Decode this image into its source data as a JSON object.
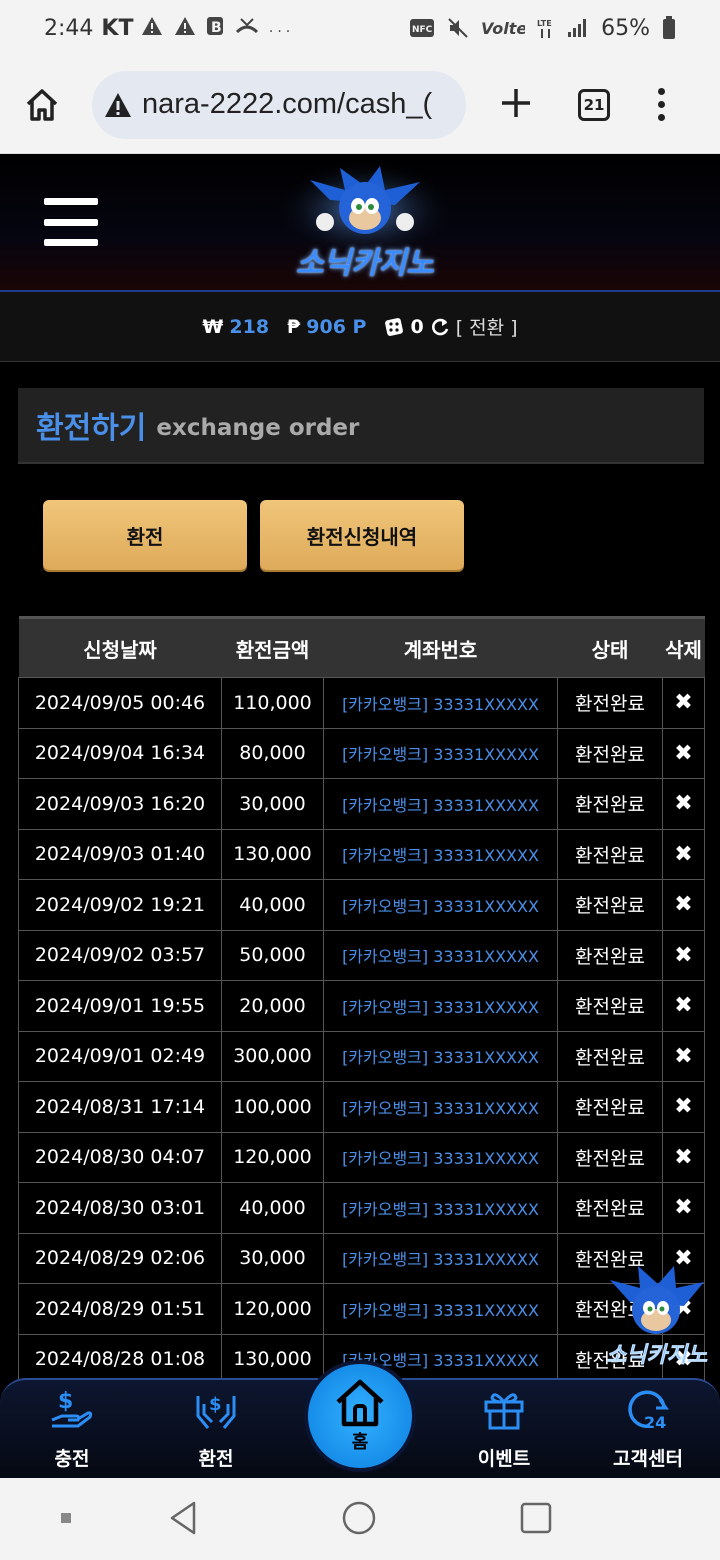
{
  "status": {
    "time": "2:44",
    "carrier": "KT",
    "battery": "65%",
    "icons": [
      "warning-icon",
      "warning-icon",
      "b-icon",
      "missed-call-icon",
      "more-icon",
      "nfc-icon",
      "mute-icon",
      "volte-icon",
      "lte-icon",
      "signal-icon",
      "battery-icon"
    ]
  },
  "browser": {
    "url": "nara-2222.com/cash_(",
    "tab_count": "21"
  },
  "site": {
    "logo_text": "소닉카지노"
  },
  "balance": {
    "won_symbol": "₩",
    "won_value": "218",
    "point_symbol": "₱",
    "point_value": "906 P",
    "chip_value": "0",
    "convert_label": "[ 전환 ]"
  },
  "page": {
    "title_ko": "환전하기",
    "title_en": "exchange order"
  },
  "buttons": {
    "exchange": "환전",
    "history": "환전신청내역"
  },
  "table": {
    "headers": [
      "신청날짜",
      "환전금액",
      "계좌번호",
      "상태",
      "삭제"
    ],
    "rows": [
      {
        "date": "2024/09/05 00:46",
        "amount": "110,000",
        "account": "[카카오뱅크] 33331XXXXX",
        "status": "환전완료",
        "del": "✖"
      },
      {
        "date": "2024/09/04 16:34",
        "amount": "80,000",
        "account": "[카카오뱅크] 33331XXXXX",
        "status": "환전완료",
        "del": "✖"
      },
      {
        "date": "2024/09/03 16:20",
        "amount": "30,000",
        "account": "[카카오뱅크] 33331XXXXX",
        "status": "환전완료",
        "del": "✖"
      },
      {
        "date": "2024/09/03 01:40",
        "amount": "130,000",
        "account": "[카카오뱅크] 33331XXXXX",
        "status": "환전완료",
        "del": "✖"
      },
      {
        "date": "2024/09/02 19:21",
        "amount": "40,000",
        "account": "[카카오뱅크] 33331XXXXX",
        "status": "환전완료",
        "del": "✖"
      },
      {
        "date": "2024/09/02 03:57",
        "amount": "50,000",
        "account": "[카카오뱅크] 33331XXXXX",
        "status": "환전완료",
        "del": "✖"
      },
      {
        "date": "2024/09/01 19:55",
        "amount": "20,000",
        "account": "[카카오뱅크] 33331XXXXX",
        "status": "환전완료",
        "del": "✖"
      },
      {
        "date": "2024/09/01 02:49",
        "amount": "300,000",
        "account": "[카카오뱅크] 33331XXXXX",
        "status": "환전완료",
        "del": "✖"
      },
      {
        "date": "2024/08/31 17:14",
        "amount": "100,000",
        "account": "[카카오뱅크] 33331XXXXX",
        "status": "환전완료",
        "del": "✖"
      },
      {
        "date": "2024/08/30 04:07",
        "amount": "120,000",
        "account": "[카카오뱅크] 33331XXXXX",
        "status": "환전완료",
        "del": "✖"
      },
      {
        "date": "2024/08/30 03:01",
        "amount": "40,000",
        "account": "[카카오뱅크] 33331XXXXX",
        "status": "환전완료",
        "del": "✖"
      },
      {
        "date": "2024/08/29 02:06",
        "amount": "30,000",
        "account": "[카카오뱅크] 33331XXXXX",
        "status": "환전완료",
        "del": "✖"
      },
      {
        "date": "2024/08/29 01:51",
        "amount": "120,000",
        "account": "[카카오뱅크] 33331XXXXX",
        "status": "환전완료",
        "del": "✖"
      },
      {
        "date": "2024/08/28 01:08",
        "amount": "130,000",
        "account": "[카카오뱅크] 33331XXXXX",
        "status": "환전완료",
        "del": "✖"
      }
    ]
  },
  "bottom_nav": {
    "charge": "충전",
    "exchange": "환전",
    "home": "홈",
    "event": "이벤트",
    "support": "고객센터"
  },
  "colors": {
    "accent_blue": "#4a8fe8",
    "button_gold": "#e8b96a",
    "home_blue": "#1a98f0"
  }
}
